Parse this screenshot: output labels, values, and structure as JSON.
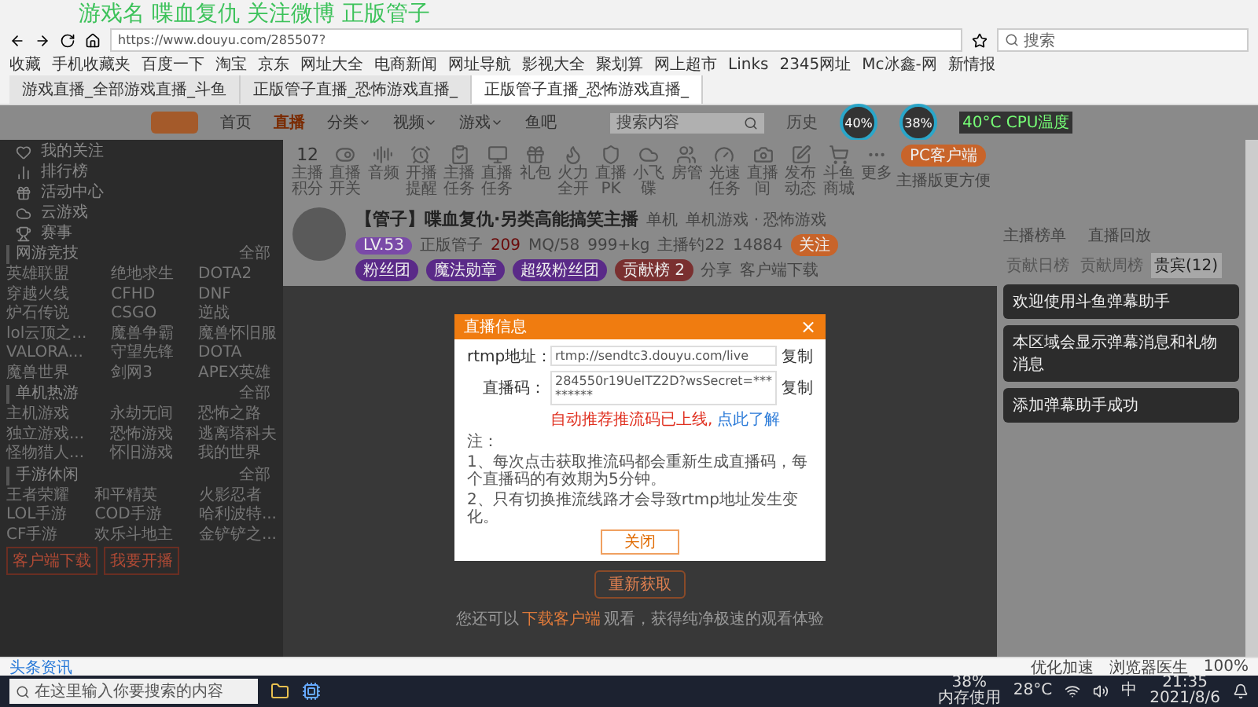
{
  "overlay_caption": "游戏名  喋血复仇  关注微博  正版管子",
  "browser": {
    "address": "https://www.douyu.com/285507?",
    "search_placeholder": "搜索",
    "bookmarks": [
      "收藏",
      "手机收藏夹",
      "百度一下",
      "淘宝",
      "京东",
      "网址大全",
      "电商新闻",
      "网址导航",
      "影视大全",
      "聚划算",
      "网上超市",
      "Links",
      "2345网址",
      "Mc冰鑫-网",
      "新情报"
    ],
    "tabs": [
      {
        "title": "游戏直播_全部游戏直播_斗鱼",
        "selected": false
      },
      {
        "title": "正版管子直播_恐怖游戏直播_",
        "selected": false
      },
      {
        "title": "正版管子直播_恐怖游戏直播_",
        "selected": true
      }
    ]
  },
  "monitor": {
    "memory": "40%",
    "cpu": "38%",
    "temperature": "40°C",
    "temperature_label": "CPU温度"
  },
  "site": {
    "nav": [
      {
        "label": "首页",
        "selected": false,
        "dropdown": false
      },
      {
        "label": "直播",
        "selected": true,
        "dropdown": false
      },
      {
        "label": "分类",
        "selected": false,
        "dropdown": true
      },
      {
        "label": "视频",
        "selected": false,
        "dropdown": true
      },
      {
        "label": "游戏",
        "selected": false,
        "dropdown": true
      },
      {
        "label": "鱼吧",
        "selected": false,
        "dropdown": false
      }
    ],
    "search_placeholder": "搜索内容",
    "history": "历史"
  },
  "sidebar": {
    "items": [
      "我的关注",
      "排行榜",
      "活动中心",
      "云游戏",
      "赛事"
    ],
    "sections": [
      {
        "title": "网游竞技",
        "more": "全部",
        "games": [
          "英雄联盟",
          "绝地求生",
          "DOTA2",
          "穿越火线",
          "CFHD",
          "DNF",
          "炉石传说",
          "CSGO",
          "逆战",
          "lol云顶之...",
          "魔兽争霸",
          "魔兽怀旧服",
          "VALORA...",
          "守望先锋",
          "DOTA",
          "魔兽世界",
          "剑网3",
          "APEX英雄"
        ]
      },
      {
        "title": "单机热游",
        "more": "全部",
        "games": [
          "主机游戏",
          "永劫无间",
          "恐怖之路",
          "独立游戏...",
          "恐怖游戏",
          "逃离塔科夫",
          "怪物猎人...",
          "怀旧游戏",
          "我的世界"
        ]
      },
      {
        "title": "手游休闲",
        "more": "全部",
        "games": [
          "王者荣耀",
          "和平精英",
          "火影忍者",
          "LOL手游",
          "COD手游",
          "哈利波特...",
          "CF手游",
          "欢乐斗地主",
          "金铲铲之..."
        ]
      }
    ],
    "buttons": [
      "客户端下载",
      "我要开播"
    ]
  },
  "tools": [
    {
      "kind": "score",
      "value": "12",
      "label": "主播积分"
    },
    {
      "kind": "toggle",
      "label": "直播开关"
    },
    {
      "kind": "wave",
      "label": "音频"
    },
    {
      "kind": "clock",
      "label": "开播提醒"
    },
    {
      "kind": "task",
      "label": "主播任务"
    },
    {
      "kind": "ad",
      "label": "直播任务"
    },
    {
      "kind": "gift",
      "label": "礼包"
    },
    {
      "kind": "fire",
      "label": "火力全开"
    },
    {
      "kind": "shield",
      "label": "直播PK"
    },
    {
      "kind": "ufo",
      "label": "小飞碟"
    },
    {
      "kind": "users",
      "label": "房管"
    },
    {
      "kind": "gauge",
      "label": "光速任务"
    },
    {
      "kind": "camera",
      "label": "直播间"
    },
    {
      "kind": "edit",
      "label": "发布动态"
    },
    {
      "kind": "cart",
      "label": "斗鱼商城"
    },
    {
      "kind": "more",
      "label": "更多"
    }
  ],
  "pc_button": "PC客户端",
  "pc_hint": "主播版更方便",
  "stream": {
    "title": "【管子】喋血复仇·另类高能搞笑主播",
    "category": "单机",
    "tags": "单机游戏 · 恐怖游戏",
    "level": "LV.53",
    "name": "正版管子",
    "heat": "209",
    "stats": [
      "MQ/58",
      "999+kg",
      "主播钓22"
    ],
    "followers": "14884",
    "follow": "关注",
    "badges": [
      "粉丝团",
      "魔法勋章",
      "超级粉丝团"
    ],
    "rank": "贡献榜 2",
    "share": "分享",
    "report": "客户端下载"
  },
  "ranking": {
    "links": [
      "主播榜单",
      "直播回放"
    ],
    "tabs": [
      {
        "label": "贡献日榜",
        "selected": false
      },
      {
        "label": "贡献周榜",
        "selected": false
      },
      {
        "label": "贵宾(12)",
        "selected": true
      }
    ]
  },
  "dialog": {
    "title": "直播信息",
    "close": "×",
    "fields": [
      {
        "label": "rtmp地址：",
        "value": "rtmp://sendtc3.douyu.com/live",
        "copy": "复制"
      },
      {
        "label": "直播码：",
        "value": "284550r19UeITZ2D?wsSecret=*********",
        "copy": "复制"
      }
    ],
    "warning": "自动推荐推流码已上线,",
    "learn_more": "点此了解",
    "note_title": "注：",
    "notes": [
      "1、每次点击获取推流码都会重新生成直播码，每个直播码的有效期为5分钟。",
      "2、只有切换推流线路才会导致rtmp地址发生变化。"
    ],
    "button": "关闭"
  },
  "refetch": "重新获取",
  "hint_before": "您还可以",
  "hint_link": "下载客户端",
  "hint_after": "观看，获得纯净极速的观看体验",
  "notifications": [
    "欢迎使用斗鱼弹幕助手",
    "本区域会显示弹幕消息和礼物消息",
    "添加弹幕助手成功"
  ],
  "status_bar": {
    "news": "头条资讯",
    "items": [
      "优化加速",
      "浏览器医生"
    ],
    "zoom": "100%"
  },
  "taskbar": {
    "search_placeholder": "在这里输入你要搜索的内容",
    "memory": "38%",
    "memory_label": "内存使用",
    "weather": "28°C",
    "ime": "中",
    "time": "21:35",
    "date": "2021/8/6"
  }
}
